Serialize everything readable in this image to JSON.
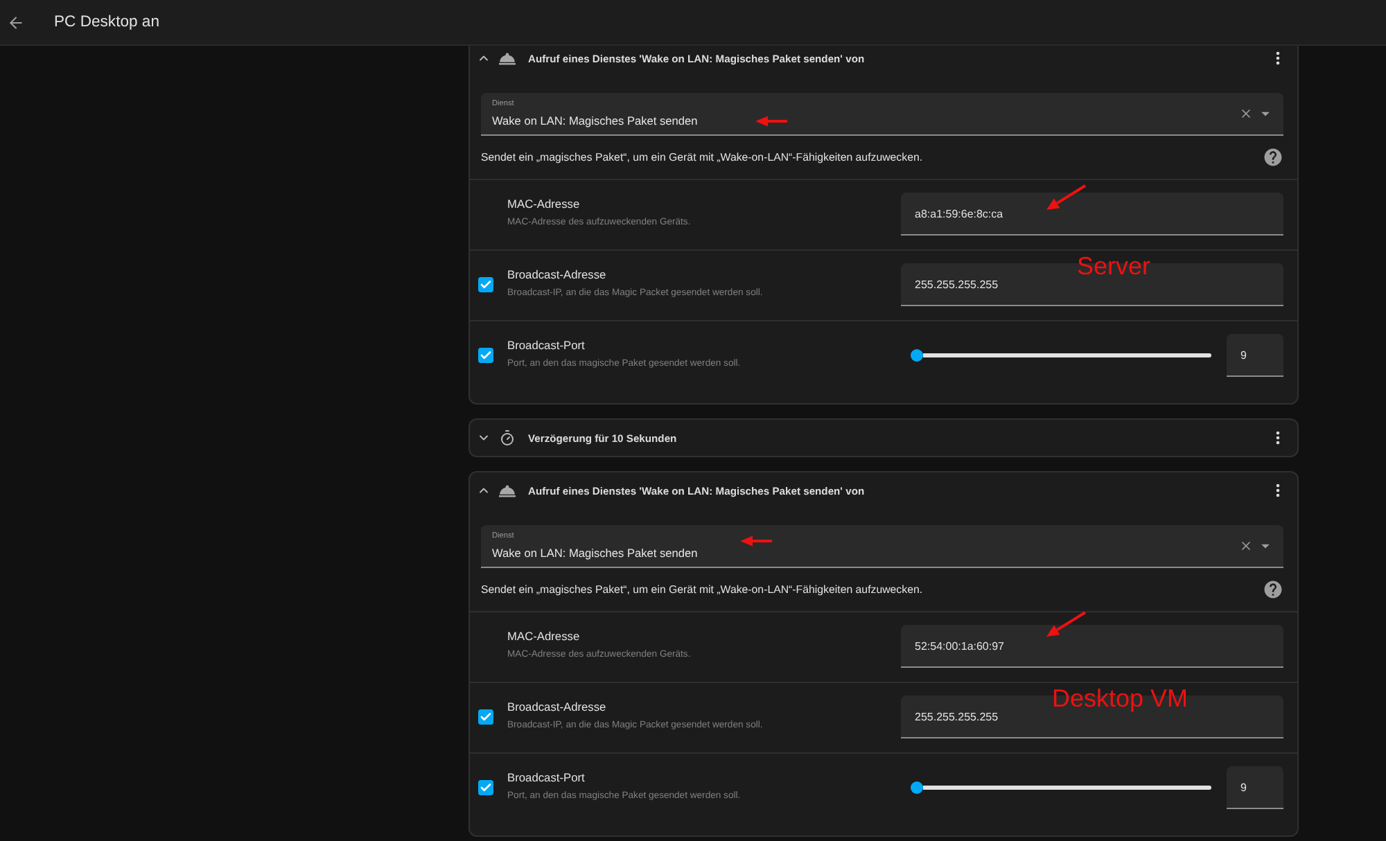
{
  "header": {
    "title": "PC Desktop an"
  },
  "actions": [
    {
      "kind": "service",
      "expanded": true,
      "title": "Aufruf eines Dienstes 'Wake on LAN: Magisches Paket senden' von",
      "service": {
        "label": "Dienst",
        "value": "Wake on LAN: Magisches Paket senden"
      },
      "description": "Sendet ein „magisches Paket“, um ein Gerät mit „Wake-on-LAN“-Fähigkeiten aufzuwecken.",
      "fields": [
        {
          "kind": "text",
          "name": "MAC-Adresse",
          "description": "MAC-Adresse des aufzuweckenden Geräts.",
          "value": "a8:a1:59:6e:8c:ca"
        },
        {
          "kind": "text",
          "checked": true,
          "name": "Broadcast-Adresse",
          "description": "Broadcast-IP, an die das Magic Packet gesendet werden soll.",
          "value": "255.255.255.255"
        },
        {
          "kind": "slider",
          "checked": true,
          "name": "Broadcast-Port",
          "description": "Port, an den das magische Paket gesendet werden soll.",
          "level": 0,
          "value": "9"
        }
      ],
      "annotation": "Server"
    },
    {
      "kind": "delay",
      "expanded": false,
      "title": "Verzögerung für 10 Sekunden"
    },
    {
      "kind": "service",
      "expanded": true,
      "title": "Aufruf eines Dienstes 'Wake on LAN: Magisches Paket senden' von",
      "service": {
        "label": "Dienst",
        "value": "Wake on LAN: Magisches Paket senden"
      },
      "description": "Sendet ein „magisches Paket“, um ein Gerät mit „Wake-on-LAN“-Fähigkeiten aufzuwecken.",
      "fields": [
        {
          "kind": "text",
          "name": "MAC-Adresse",
          "description": "MAC-Adresse des aufzuweckenden Geräts.",
          "value": "52:54:00:1a:60:97"
        },
        {
          "kind": "text",
          "checked": true,
          "name": "Broadcast-Adresse",
          "description": "Broadcast-IP, an die das Magic Packet gesendet werden soll.",
          "value": "255.255.255.255"
        },
        {
          "kind": "slider",
          "checked": true,
          "name": "Broadcast-Port",
          "description": "Port, an den das magische Paket gesendet werden soll.",
          "level": 0,
          "value": "9"
        }
      ],
      "annotation": "Desktop VM"
    }
  ]
}
